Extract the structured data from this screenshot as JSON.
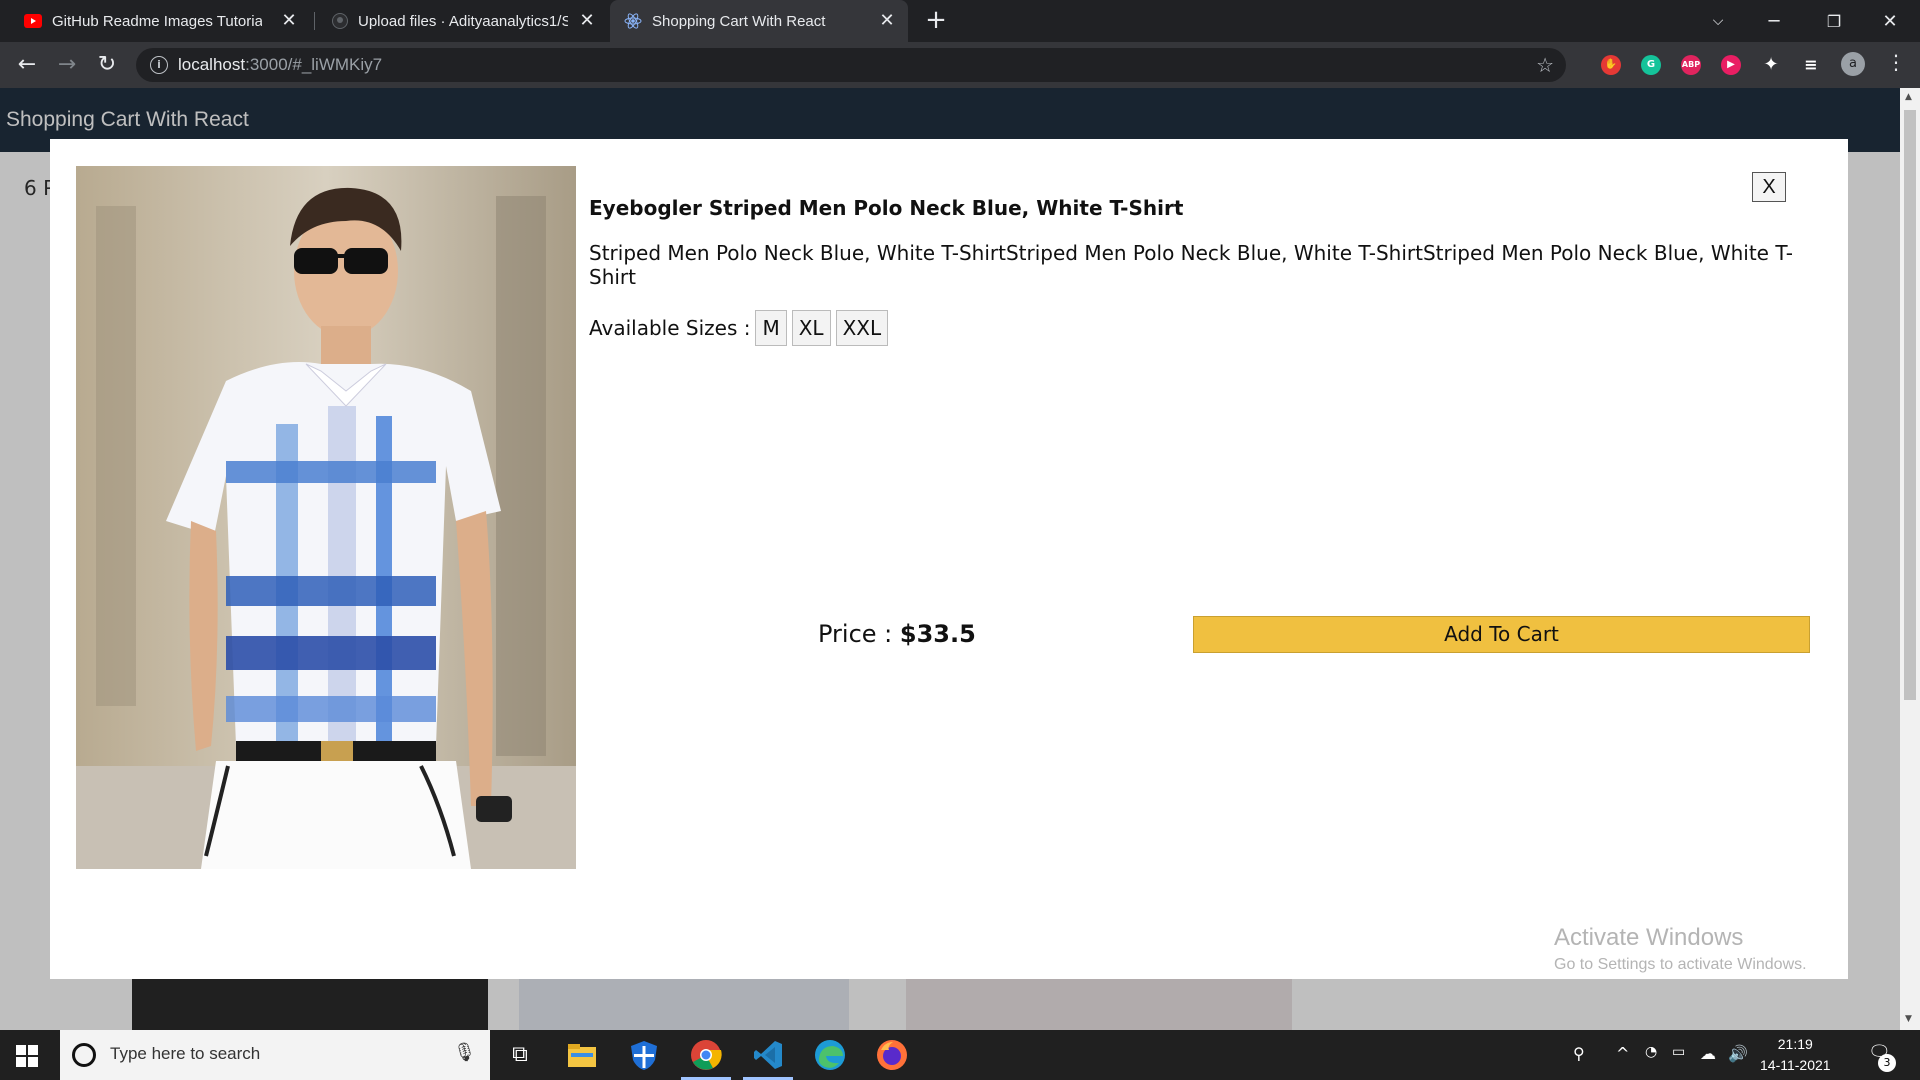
{
  "browser": {
    "tabs": [
      {
        "title": "GitHub Readme Images Tutorial (",
        "icon": "youtube-icon",
        "active": false
      },
      {
        "title": "Upload files · Adityaanalytics1/Sh",
        "icon": "github-icon",
        "active": false
      },
      {
        "title": "Shopping Cart With React",
        "icon": "react-icon",
        "active": true
      }
    ],
    "url_host": "localhost",
    "url_path": ":3000/#_liWMKiy7"
  },
  "app": {
    "title": "Shopping Cart With React",
    "filter_partial": "6 P"
  },
  "modal": {
    "close_label": "X",
    "product_title": "Eyebogler Striped Men Polo Neck Blue, White T-Shirt",
    "description": "Striped Men Polo Neck Blue, White T-ShirtStriped Men Polo Neck Blue, White T-ShirtStriped Men Polo Neck Blue, White T-Shirt",
    "sizes_label": "Available Sizes :",
    "sizes": [
      "M",
      "XL",
      "XXL"
    ],
    "price_label": "Price :",
    "price_value": "$33.5",
    "add_to_cart_label": "Add To Cart"
  },
  "watermark": {
    "line1": "Activate Windows",
    "line2": "Go to Settings to activate Windows."
  },
  "taskbar": {
    "search_placeholder": "Type here to search",
    "time": "21:19",
    "date": "14-11-2021",
    "notifications": "3"
  },
  "colors": {
    "add_to_cart": "#f0c040",
    "header": "#203040"
  }
}
